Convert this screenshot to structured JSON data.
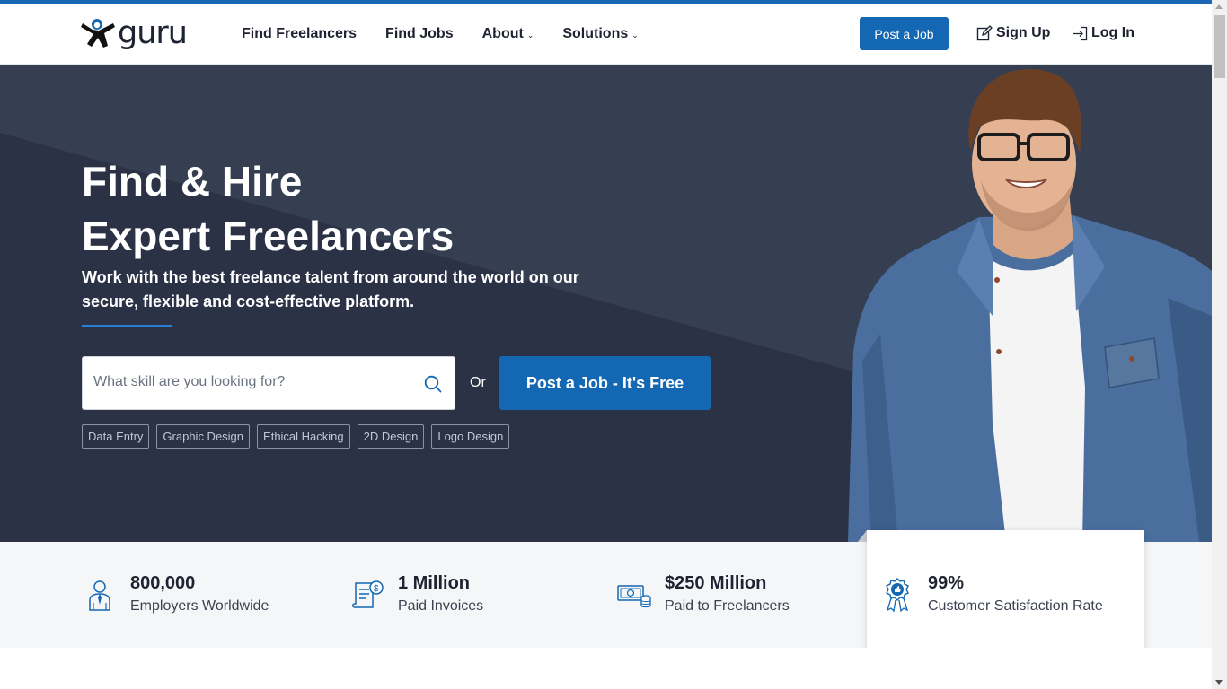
{
  "header": {
    "logo_text": "guru",
    "nav": [
      {
        "label": "Find Freelancers",
        "dropdown": false
      },
      {
        "label": "Find Jobs",
        "dropdown": false
      },
      {
        "label": "About",
        "dropdown": true
      },
      {
        "label": "Solutions",
        "dropdown": true
      }
    ],
    "post_job_label": "Post a Job",
    "signup_label": "Sign Up",
    "login_label": "Log In"
  },
  "hero": {
    "title_line1": "Find & Hire",
    "title_line2": "Expert Freelancers",
    "subtitle": "Work with the best freelance talent from around the world on our secure, flexible and cost-effective platform.",
    "search_placeholder": "What skill are you looking for?",
    "or_label": "Or",
    "post_job_cta": "Post a Job - It's Free",
    "chips": [
      "Data Entry",
      "Graphic Design",
      "Ethical Hacking",
      "2D Design",
      "Logo Design"
    ]
  },
  "stats": [
    {
      "number": "800,000",
      "label": "Employers Worldwide",
      "icon": "employer-icon"
    },
    {
      "number": "1 Million",
      "label": "Paid Invoices",
      "icon": "invoice-icon"
    },
    {
      "number": "$250 Million",
      "label": "Paid to Freelancers",
      "icon": "money-icon"
    },
    {
      "number": "99%",
      "label": "Customer Satisfaction Rate",
      "icon": "award-icon"
    }
  ],
  "colors": {
    "brand_blue": "#1467b2",
    "hero_bg": "#363e52",
    "hero_bg_dark": "#2b3246",
    "accent_line": "#2a7fd4",
    "text_dark": "#1d2330"
  }
}
